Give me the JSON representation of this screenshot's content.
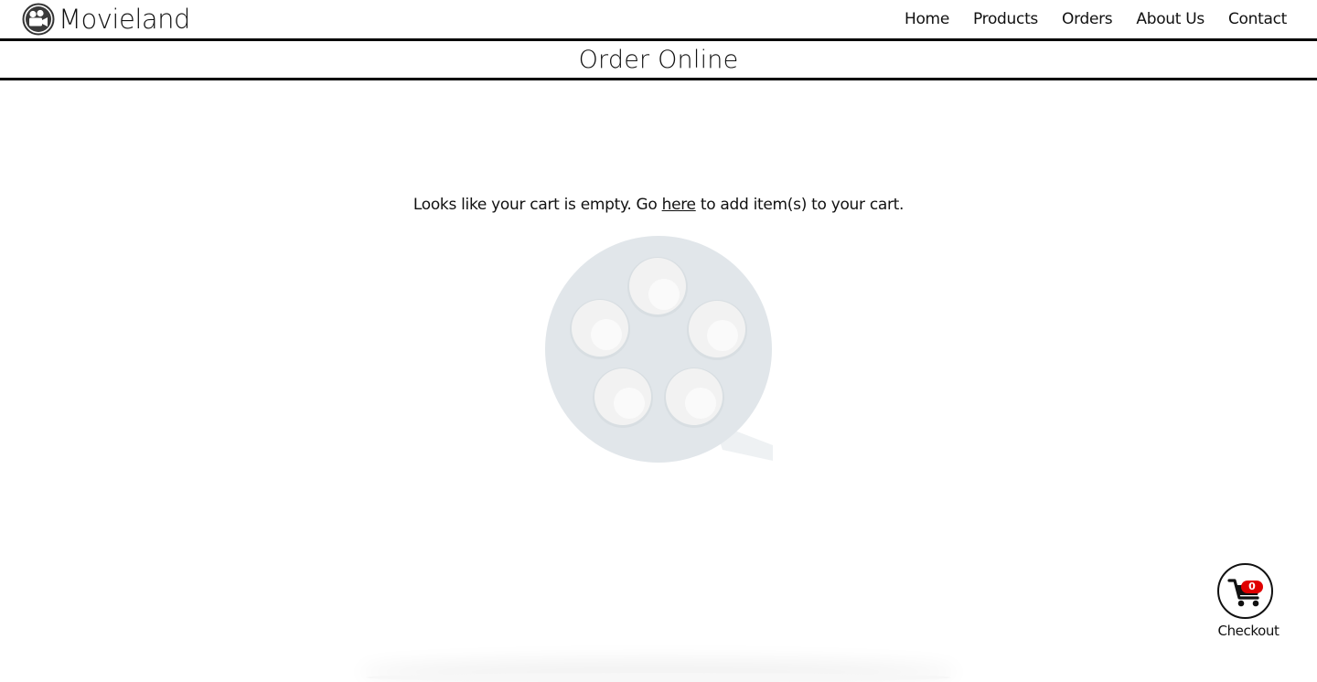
{
  "header": {
    "brand_name": "Movieland",
    "logo_icon": "film-camera-icon",
    "nav": [
      {
        "label": "Home"
      },
      {
        "label": "Products"
      },
      {
        "label": "Orders"
      },
      {
        "label": "About Us"
      },
      {
        "label": "Contact"
      }
    ]
  },
  "page": {
    "title": "Order Online"
  },
  "cart": {
    "empty_prefix": "Looks like your cart is empty. Go ",
    "empty_link": "here",
    "empty_suffix": " to add item(s) to your cart.",
    "illustration_icon": "film-reel-icon",
    "reel_color": "#e1e6ea"
  },
  "checkout": {
    "label": "Checkout",
    "count": "0",
    "icon": "shopping-cart-icon",
    "badge_color": "#e00000"
  }
}
